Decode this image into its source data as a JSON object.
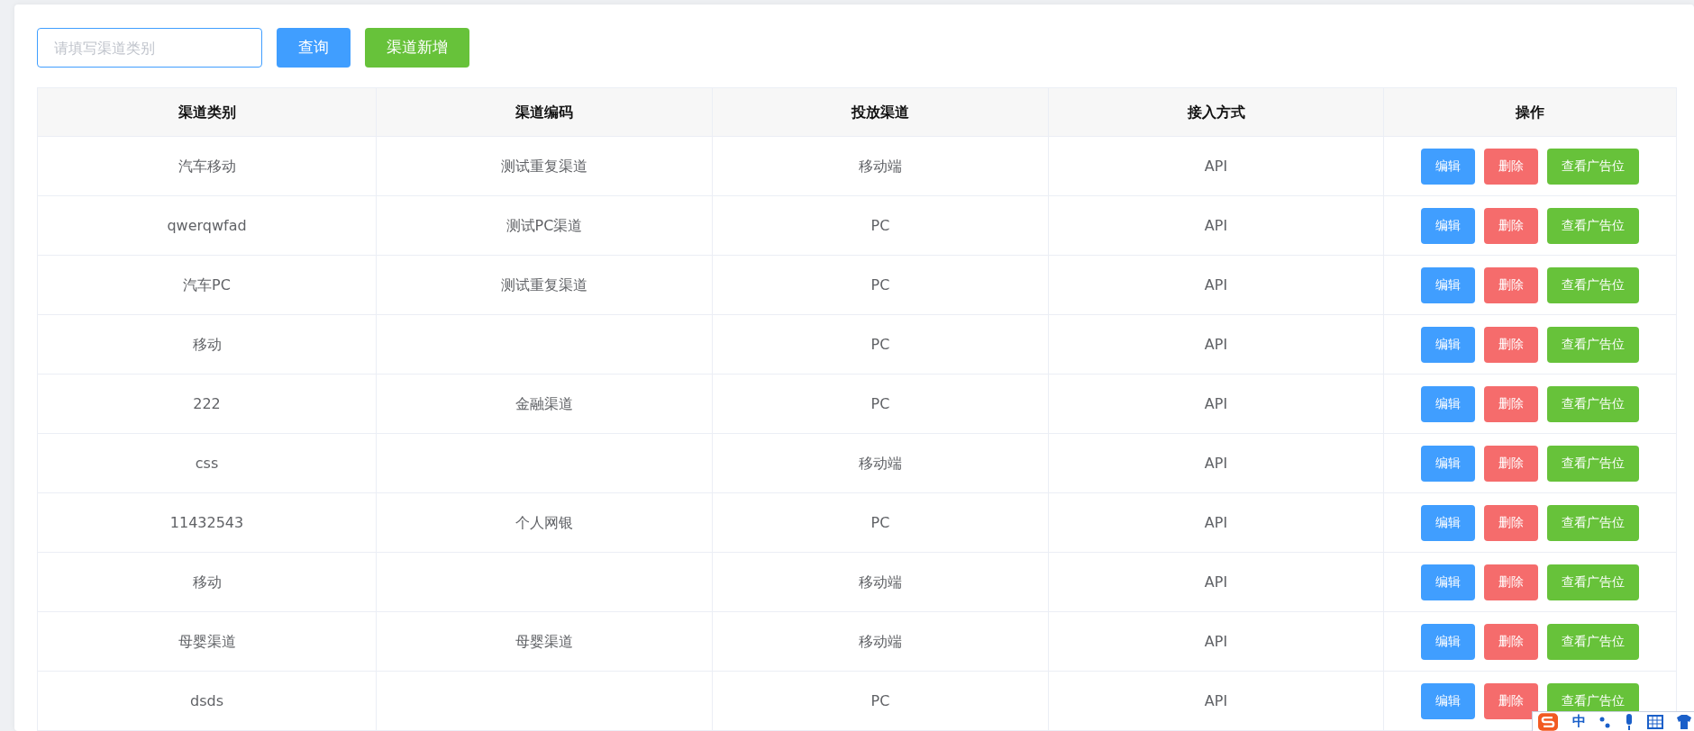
{
  "search": {
    "placeholder": "请填写渠道类别"
  },
  "toolbar_buttons": [
    {
      "label": "查询",
      "kind": "primary"
    },
    {
      "label": "渠道新增",
      "kind": "success"
    }
  ],
  "table": {
    "columns": [
      "渠道类别",
      "渠道编码",
      "投放渠道",
      "接入方式",
      "操作"
    ],
    "rows": [
      {
        "cells": [
          "汽车移动",
          "测试重复渠道",
          "移动端",
          "API"
        ],
        "actions": [
          "编辑",
          "删除",
          "查看广告位"
        ]
      },
      {
        "cells": [
          "qwerqwfad",
          "测试PC渠道",
          "PC",
          "API"
        ],
        "actions": [
          "编辑",
          "删除",
          "查看广告位"
        ]
      },
      {
        "cells": [
          "汽车PC",
          "测试重复渠道",
          "PC",
          "API"
        ],
        "actions": [
          "编辑",
          "删除",
          "查看广告位"
        ]
      },
      {
        "cells": [
          "移动",
          "",
          "PC",
          "API"
        ],
        "actions": [
          "编辑",
          "删除",
          "查看广告位"
        ]
      },
      {
        "cells": [
          "222",
          "金融渠道",
          "PC",
          "API"
        ],
        "actions": [
          "编辑",
          "删除",
          "查看广告位"
        ]
      },
      {
        "cells": [
          "css",
          "",
          "移动端",
          "API"
        ],
        "actions": [
          "编辑",
          "删除",
          "查看广告位"
        ]
      },
      {
        "cells": [
          "11432543",
          "个人网银",
          "PC",
          "API"
        ],
        "actions": [
          "编辑",
          "删除",
          "查看广告位"
        ]
      },
      {
        "cells": [
          "移动",
          "",
          "移动端",
          "API"
        ],
        "actions": [
          "编辑",
          "删除",
          "查看广告位"
        ]
      },
      {
        "cells": [
          "母婴渠道",
          "母婴渠道",
          "移动端",
          "API"
        ],
        "actions": [
          "编辑",
          "删除",
          "查看广告位"
        ]
      },
      {
        "cells": [
          "dsds",
          "",
          "PC",
          "API"
        ],
        "actions": [
          "编辑",
          "删除",
          "查看广告位"
        ]
      }
    ]
  },
  "ime_toolbar": {
    "label": "中"
  }
}
